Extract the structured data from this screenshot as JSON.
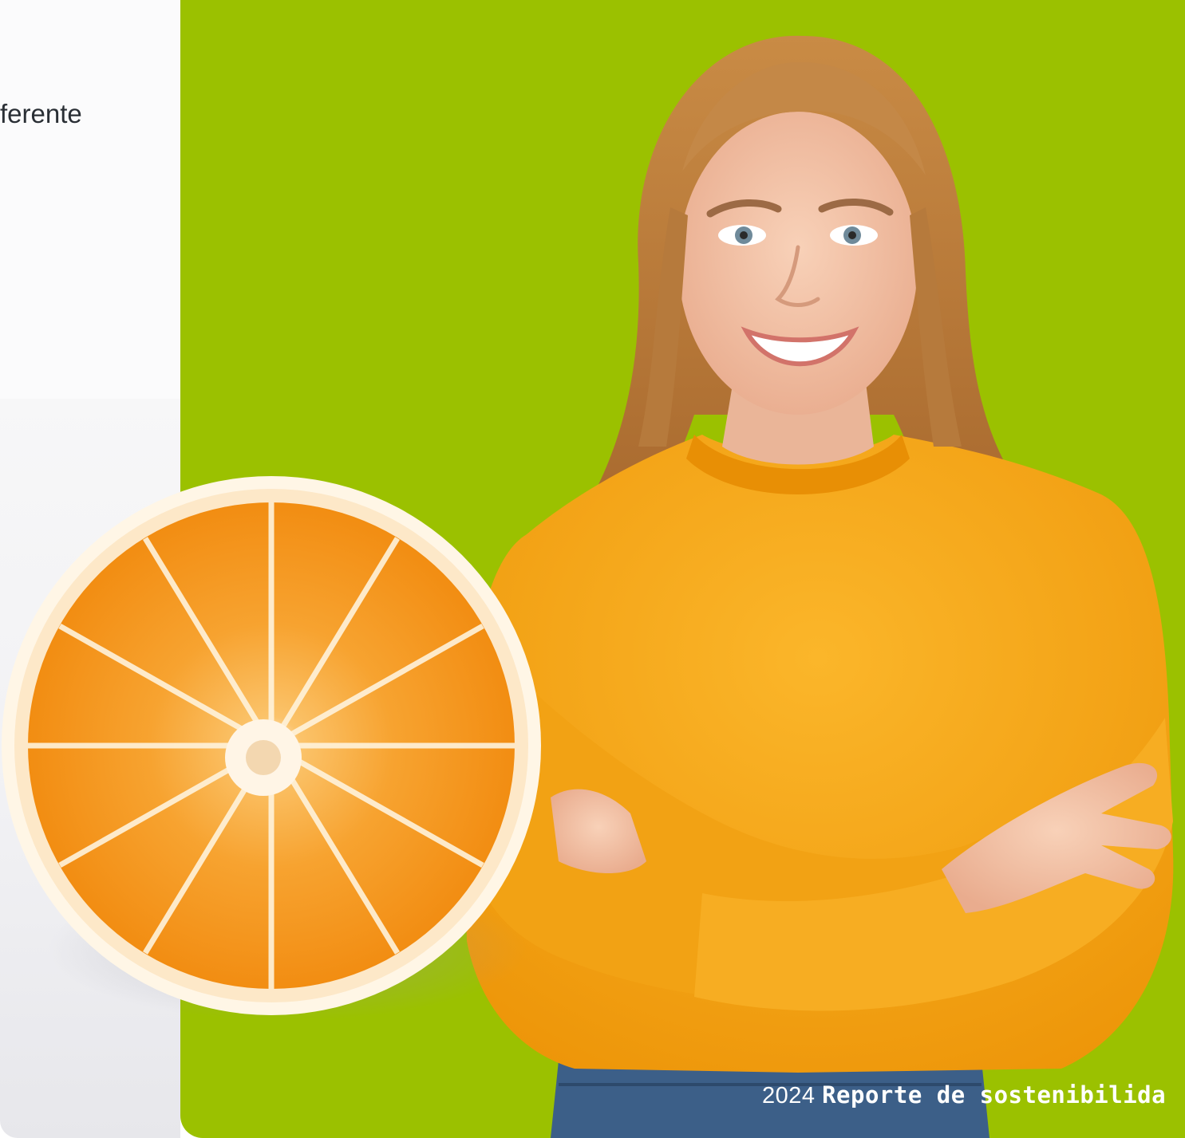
{
  "text_snippet": "ferente",
  "footer": {
    "year": "2024",
    "report_title": "Reporte de sostenibilida"
  },
  "colors": {
    "green_background": "#9bc100",
    "sweater_orange": "#f5a410",
    "orange_fruit": "#f59a1f",
    "text_dark": "#2a2f35"
  },
  "illustration": {
    "subject": "smiling-woman-with-crossed-arms",
    "fruit": "halved-orange"
  }
}
